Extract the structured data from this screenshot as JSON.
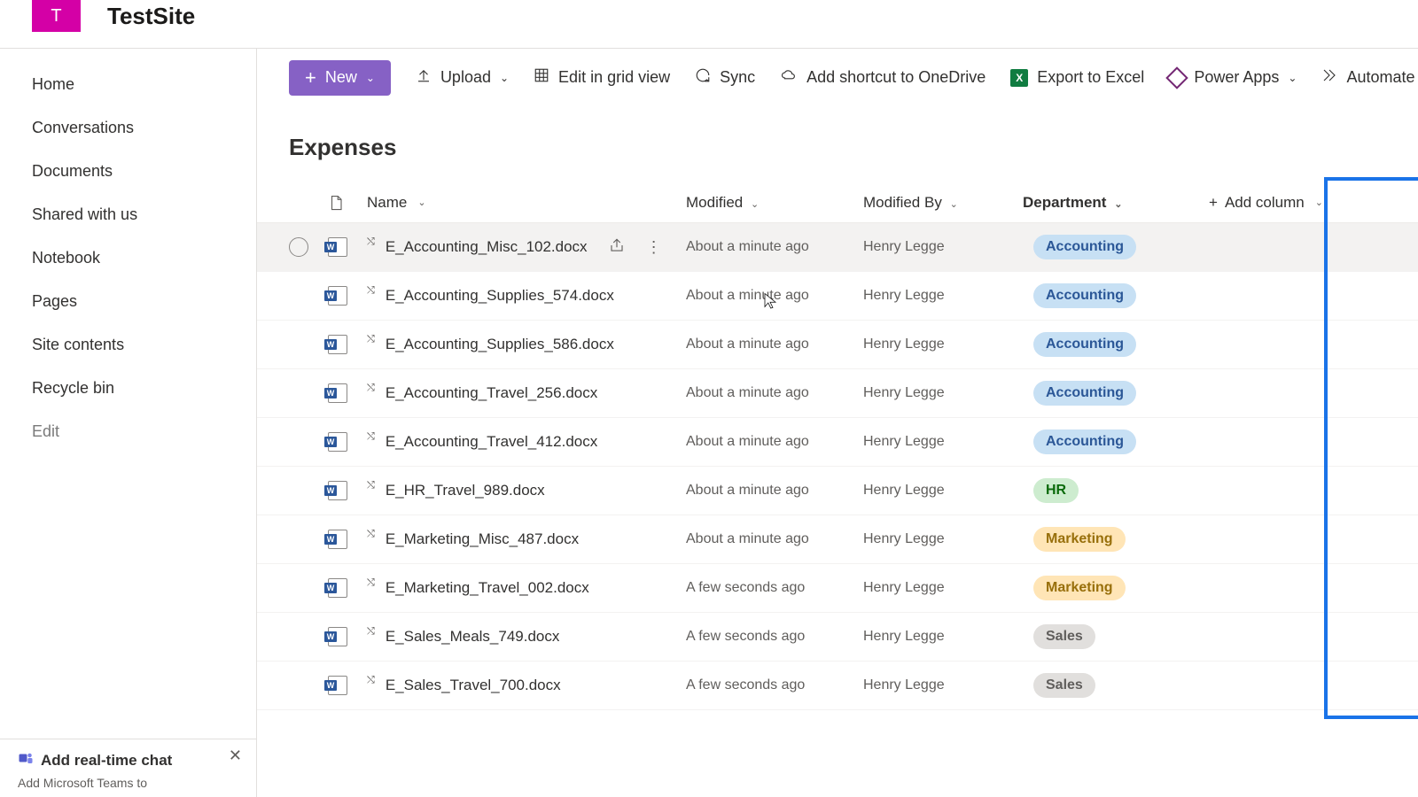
{
  "site": {
    "logo_letter": "T",
    "title": "TestSite"
  },
  "sidebar": {
    "items": [
      {
        "label": "Home"
      },
      {
        "label": "Conversations"
      },
      {
        "label": "Documents"
      },
      {
        "label": "Shared with us"
      },
      {
        "label": "Notebook"
      },
      {
        "label": "Pages"
      },
      {
        "label": "Site contents"
      },
      {
        "label": "Recycle bin"
      },
      {
        "label": "Edit"
      }
    ]
  },
  "promo": {
    "title": "Add real-time chat",
    "subtitle": "Add Microsoft Teams to"
  },
  "toolbar": {
    "new_label": "New",
    "upload_label": "Upload",
    "edit_grid_label": "Edit in grid view",
    "sync_label": "Sync",
    "onedrive_label": "Add shortcut to OneDrive",
    "excel_label": "Export to Excel",
    "powerapps_label": "Power Apps",
    "automate_label": "Automate"
  },
  "list": {
    "title": "Expenses",
    "columns": {
      "name": "Name",
      "modified": "Modified",
      "modified_by": "Modified By",
      "department": "Department",
      "add": "Add column"
    },
    "rows": [
      {
        "name": "E_Accounting_Misc_102.docx",
        "modified": "About a minute ago",
        "by": "Henry Legge",
        "dept": "Accounting",
        "hovered": true
      },
      {
        "name": "E_Accounting_Supplies_574.docx",
        "modified": "About a minute ago",
        "by": "Henry Legge",
        "dept": "Accounting"
      },
      {
        "name": "E_Accounting_Supplies_586.docx",
        "modified": "About a minute ago",
        "by": "Henry Legge",
        "dept": "Accounting"
      },
      {
        "name": "E_Accounting_Travel_256.docx",
        "modified": "About a minute ago",
        "by": "Henry Legge",
        "dept": "Accounting"
      },
      {
        "name": "E_Accounting_Travel_412.docx",
        "modified": "About a minute ago",
        "by": "Henry Legge",
        "dept": "Accounting"
      },
      {
        "name": "E_HR_Travel_989.docx",
        "modified": "About a minute ago",
        "by": "Henry Legge",
        "dept": "HR"
      },
      {
        "name": "E_Marketing_Misc_487.docx",
        "modified": "About a minute ago",
        "by": "Henry Legge",
        "dept": "Marketing"
      },
      {
        "name": "E_Marketing_Travel_002.docx",
        "modified": "A few seconds ago",
        "by": "Henry Legge",
        "dept": "Marketing"
      },
      {
        "name": "E_Sales_Meals_749.docx",
        "modified": "A few seconds ago",
        "by": "Henry Legge",
        "dept": "Sales"
      },
      {
        "name": "E_Sales_Travel_700.docx",
        "modified": "A few seconds ago",
        "by": "Henry Legge",
        "dept": "Sales"
      }
    ]
  }
}
